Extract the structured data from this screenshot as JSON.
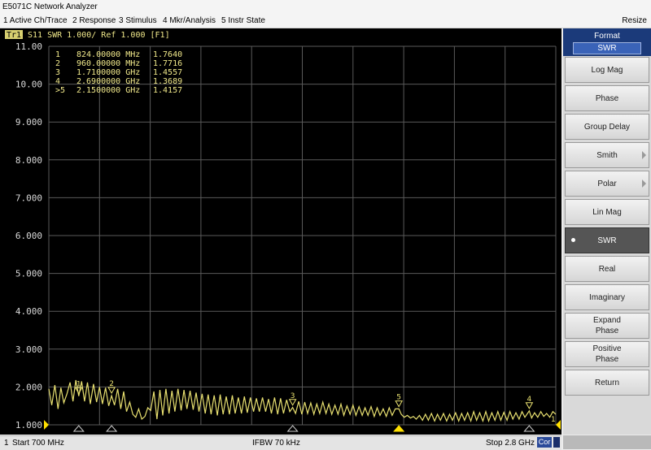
{
  "window": {
    "title": "E5071C Network Analyzer",
    "resize_label": "Resize"
  },
  "menu": [
    {
      "label": "1 Active Ch/Trace"
    },
    {
      "label": "2 Response"
    },
    {
      "label": "3 Stimulus"
    },
    {
      "label": "4 Mkr/Analysis"
    },
    {
      "label": "5 Instr State"
    }
  ],
  "trace_header": {
    "badge": "Tr1",
    "text": "S11  SWR 1.000/ Ref 1.000 [F1]"
  },
  "markers": [
    {
      "id": "1",
      "freq": "824.00000 MHz",
      "value": "1.7640",
      "active": false
    },
    {
      "id": "2",
      "freq": "960.00000 MHz",
      "value": "1.7716",
      "active": false
    },
    {
      "id": "3",
      "freq": "1.7100000 GHz",
      "value": "1.4557",
      "active": false
    },
    {
      "id": "4",
      "freq": "2.6900000 GHz",
      "value": "1.3689",
      "active": false
    },
    {
      "id": "5",
      "freq": "2.1500000 GHz",
      "value": "1.4157",
      "active": true
    }
  ],
  "colors": {
    "trace": "#e8e070",
    "grid": "#5a5a5a",
    "text": "#d8d8d8",
    "marker_text": "#f0e88a",
    "active_marker": "#ffe000"
  },
  "format_menu": {
    "title": "Format",
    "current": "SWR",
    "items": [
      {
        "label": "Log Mag",
        "active": false,
        "submenu": false
      },
      {
        "label": "Phase",
        "active": false,
        "submenu": false
      },
      {
        "label": "Group Delay",
        "active": false,
        "submenu": false
      },
      {
        "label": "Smith",
        "active": false,
        "submenu": true
      },
      {
        "label": "Polar",
        "active": false,
        "submenu": true
      },
      {
        "label": "Lin Mag",
        "active": false,
        "submenu": false
      },
      {
        "label": "SWR",
        "active": true,
        "submenu": false
      },
      {
        "label": "Real",
        "active": false,
        "submenu": false
      },
      {
        "label": "Imaginary",
        "active": false,
        "submenu": false
      },
      {
        "label": "Expand\nPhase",
        "active": false,
        "submenu": false
      },
      {
        "label": "Positive\nPhase",
        "active": false,
        "submenu": false
      },
      {
        "label": "Return",
        "active": false,
        "submenu": false
      }
    ]
  },
  "status": {
    "channel": "1",
    "start": "Start 700 MHz",
    "ifbw": "IFBW 70 kHz",
    "stop": "Stop 2.8 GHz",
    "cor": "Cor"
  },
  "chart_data": {
    "type": "line",
    "xlim": [
      700,
      2800
    ],
    "ylim": [
      1.0,
      11.0
    ],
    "y_ticks": [
      "11.00",
      "10.00",
      "9.000",
      "8.000",
      "7.000",
      "6.000",
      "5.000",
      "4.000",
      "3.000",
      "2.000",
      "1.000"
    ],
    "grid": true,
    "x_divisions": 10,
    "series": [
      {
        "values": [
          [
            700,
            1.95
          ],
          [
            712,
            1.52
          ],
          [
            725,
            2.05
          ],
          [
            738,
            1.42
          ],
          [
            750,
            1.98
          ],
          [
            762,
            1.58
          ],
          [
            775,
            1.82
          ],
          [
            788,
            2.12
          ],
          [
            800,
            1.62
          ],
          [
            812,
            2.18
          ],
          [
            824,
            1.76
          ],
          [
            836,
            2.15
          ],
          [
            848,
            1.62
          ],
          [
            860,
            2.12
          ],
          [
            872,
            1.55
          ],
          [
            885,
            2.08
          ],
          [
            898,
            1.6
          ],
          [
            910,
            2.0
          ],
          [
            922,
            1.55
          ],
          [
            935,
            1.98
          ],
          [
            948,
            1.5
          ],
          [
            960,
            1.77
          ],
          [
            972,
            1.52
          ],
          [
            985,
            1.95
          ],
          [
            998,
            1.42
          ],
          [
            1010,
            1.88
          ],
          [
            1022,
            1.35
          ],
          [
            1035,
            1.6
          ],
          [
            1048,
            1.28
          ],
          [
            1060,
            1.2
          ],
          [
            1072,
            1.42
          ],
          [
            1085,
            1.15
          ],
          [
            1098,
            1.22
          ],
          [
            1110,
            1.45
          ],
          [
            1122,
            1.38
          ],
          [
            1135,
            1.88
          ],
          [
            1148,
            1.15
          ],
          [
            1160,
            1.92
          ],
          [
            1172,
            1.25
          ],
          [
            1185,
            1.95
          ],
          [
            1198,
            1.3
          ],
          [
            1210,
            1.9
          ],
          [
            1222,
            1.35
          ],
          [
            1235,
            1.95
          ],
          [
            1248,
            1.38
          ],
          [
            1260,
            1.92
          ],
          [
            1272,
            1.42
          ],
          [
            1285,
            1.9
          ],
          [
            1298,
            1.4
          ],
          [
            1310,
            1.85
          ],
          [
            1322,
            1.35
          ],
          [
            1335,
            1.82
          ],
          [
            1348,
            1.3
          ],
          [
            1360,
            1.8
          ],
          [
            1372,
            1.28
          ],
          [
            1385,
            1.78
          ],
          [
            1398,
            1.25
          ],
          [
            1410,
            1.8
          ],
          [
            1422,
            1.28
          ],
          [
            1435,
            1.75
          ],
          [
            1448,
            1.28
          ],
          [
            1460,
            1.78
          ],
          [
            1472,
            1.3
          ],
          [
            1485,
            1.72
          ],
          [
            1498,
            1.3
          ],
          [
            1510,
            1.75
          ],
          [
            1522,
            1.32
          ],
          [
            1535,
            1.72
          ],
          [
            1548,
            1.35
          ],
          [
            1560,
            1.7
          ],
          [
            1572,
            1.35
          ],
          [
            1585,
            1.72
          ],
          [
            1598,
            1.35
          ],
          [
            1610,
            1.68
          ],
          [
            1622,
            1.3
          ],
          [
            1635,
            1.72
          ],
          [
            1648,
            1.28
          ],
          [
            1660,
            1.7
          ],
          [
            1672,
            1.3
          ],
          [
            1685,
            1.66
          ],
          [
            1698,
            1.35
          ],
          [
            1710,
            1.46
          ],
          [
            1722,
            1.3
          ],
          [
            1735,
            1.62
          ],
          [
            1748,
            1.28
          ],
          [
            1760,
            1.6
          ],
          [
            1772,
            1.3
          ],
          [
            1785,
            1.58
          ],
          [
            1798,
            1.28
          ],
          [
            1810,
            1.55
          ],
          [
            1822,
            1.3
          ],
          [
            1835,
            1.6
          ],
          [
            1848,
            1.3
          ],
          [
            1860,
            1.55
          ],
          [
            1872,
            1.28
          ],
          [
            1885,
            1.52
          ],
          [
            1898,
            1.28
          ],
          [
            1910,
            1.55
          ],
          [
            1922,
            1.25
          ],
          [
            1935,
            1.5
          ],
          [
            1948,
            1.28
          ],
          [
            1960,
            1.52
          ],
          [
            1972,
            1.25
          ],
          [
            1985,
            1.48
          ],
          [
            1998,
            1.25
          ],
          [
            2010,
            1.45
          ],
          [
            2022,
            1.25
          ],
          [
            2035,
            1.48
          ],
          [
            2048,
            1.22
          ],
          [
            2060,
            1.45
          ],
          [
            2072,
            1.25
          ],
          [
            2085,
            1.42
          ],
          [
            2098,
            1.22
          ],
          [
            2110,
            1.45
          ],
          [
            2122,
            1.25
          ],
          [
            2135,
            1.42
          ],
          [
            2150,
            1.42
          ],
          [
            2160,
            1.28
          ],
          [
            2172,
            1.2
          ],
          [
            2185,
            1.25
          ],
          [
            2198,
            1.18
          ],
          [
            2210,
            1.22
          ],
          [
            2222,
            1.15
          ],
          [
            2235,
            1.25
          ],
          [
            2248,
            1.12
          ],
          [
            2260,
            1.28
          ],
          [
            2272,
            1.12
          ],
          [
            2285,
            1.3
          ],
          [
            2298,
            1.1
          ],
          [
            2310,
            1.28
          ],
          [
            2322,
            1.12
          ],
          [
            2335,
            1.3
          ],
          [
            2348,
            1.1
          ],
          [
            2360,
            1.28
          ],
          [
            2372,
            1.12
          ],
          [
            2385,
            1.32
          ],
          [
            2398,
            1.1
          ],
          [
            2410,
            1.3
          ],
          [
            2422,
            1.12
          ],
          [
            2435,
            1.32
          ],
          [
            2448,
            1.1
          ],
          [
            2460,
            1.35
          ],
          [
            2472,
            1.12
          ],
          [
            2485,
            1.32
          ],
          [
            2498,
            1.1
          ],
          [
            2510,
            1.35
          ],
          [
            2522,
            1.1
          ],
          [
            2535,
            1.32
          ],
          [
            2548,
            1.12
          ],
          [
            2560,
            1.35
          ],
          [
            2572,
            1.12
          ],
          [
            2585,
            1.33
          ],
          [
            2598,
            1.12
          ],
          [
            2610,
            1.35
          ],
          [
            2622,
            1.15
          ],
          [
            2635,
            1.32
          ],
          [
            2648,
            1.15
          ],
          [
            2660,
            1.35
          ],
          [
            2672,
            1.2
          ],
          [
            2690,
            1.37
          ],
          [
            2700,
            1.18
          ],
          [
            2712,
            1.32
          ],
          [
            2725,
            1.2
          ],
          [
            2738,
            1.35
          ],
          [
            2750,
            1.22
          ],
          [
            2762,
            1.3
          ],
          [
            2775,
            1.2
          ],
          [
            2788,
            1.35
          ],
          [
            2800,
            1.28
          ]
        ]
      }
    ],
    "marker_points": [
      {
        "id": "1",
        "x": 824,
        "y": 1.764
      },
      {
        "id": "2",
        "x": 960,
        "y": 1.7716
      },
      {
        "id": "3",
        "x": 1710,
        "y": 1.4557
      },
      {
        "id": "4",
        "x": 2690,
        "y": 1.3689
      },
      {
        "id": "5",
        "x": 2150,
        "y": 1.4157
      }
    ]
  }
}
